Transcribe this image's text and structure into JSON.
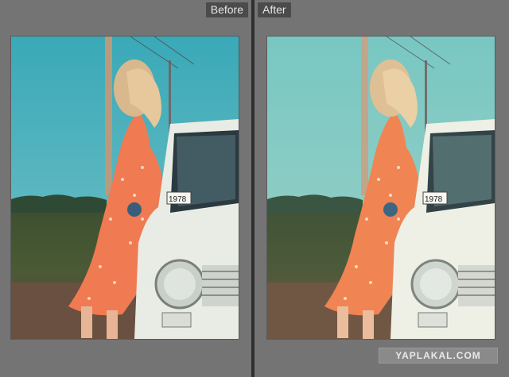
{
  "before_label": "Before",
  "after_label": "After",
  "plate_text": "1978",
  "watermark": "YAPLAKAL.COM",
  "icons": [
    "photo-before",
    "photo-after"
  ],
  "colors": {
    "before_sky_top": "#3aa9b8",
    "before_sky_bottom": "#77c2c8",
    "after_sky_top": "#79c7c2",
    "after_sky_bottom": "#9ad0c6",
    "dress": "#f07a52",
    "car": "#e8ece4",
    "field": "#3e5030"
  }
}
